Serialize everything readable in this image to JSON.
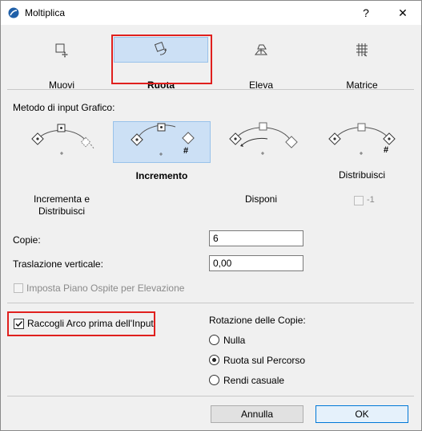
{
  "window": {
    "title": "Moltiplica",
    "help_glyph": "?",
    "close_glyph": "✕"
  },
  "tabs": [
    {
      "label": "Muovi",
      "icon": "move-icon"
    },
    {
      "label": "Ruota",
      "icon": "rotate-icon"
    },
    {
      "label": "Eleva",
      "icon": "elevate-icon"
    },
    {
      "label": "Matrice",
      "icon": "matrix-icon"
    }
  ],
  "selected_tab": "Ruota",
  "input_method": {
    "label": "Metodo di input Grafico:",
    "modes": [
      {
        "label": "Incrementa e Distribuisci"
      },
      {
        "label": "Incremento"
      },
      {
        "label": "Disponi"
      },
      {
        "label": "Distribuisci"
      }
    ],
    "selected": "Incremento",
    "mark_hash": "#",
    "extra_option": "-1"
  },
  "fields": {
    "copies_label": "Copie:",
    "copies_value": "6",
    "vertical_label": "Traslazione verticale:",
    "vertical_value": "0,00",
    "host_floor_label": "Imposta Piano Ospite per Elevazione"
  },
  "collect_arc": {
    "label": "Raccogli Arco prima dell'Input",
    "checked": true
  },
  "rotation": {
    "label": "Rotazione delle Copie:",
    "options": [
      "Nulla",
      "Ruota sul Percorso",
      "Rendi casuale"
    ],
    "selected": "Ruota sul Percorso"
  },
  "buttons": {
    "cancel": "Annulla",
    "ok": "OK"
  },
  "colors": {
    "highlight": "#cce0f5",
    "red_outline": "#e0201e",
    "default_button_border": "#0078d7"
  }
}
